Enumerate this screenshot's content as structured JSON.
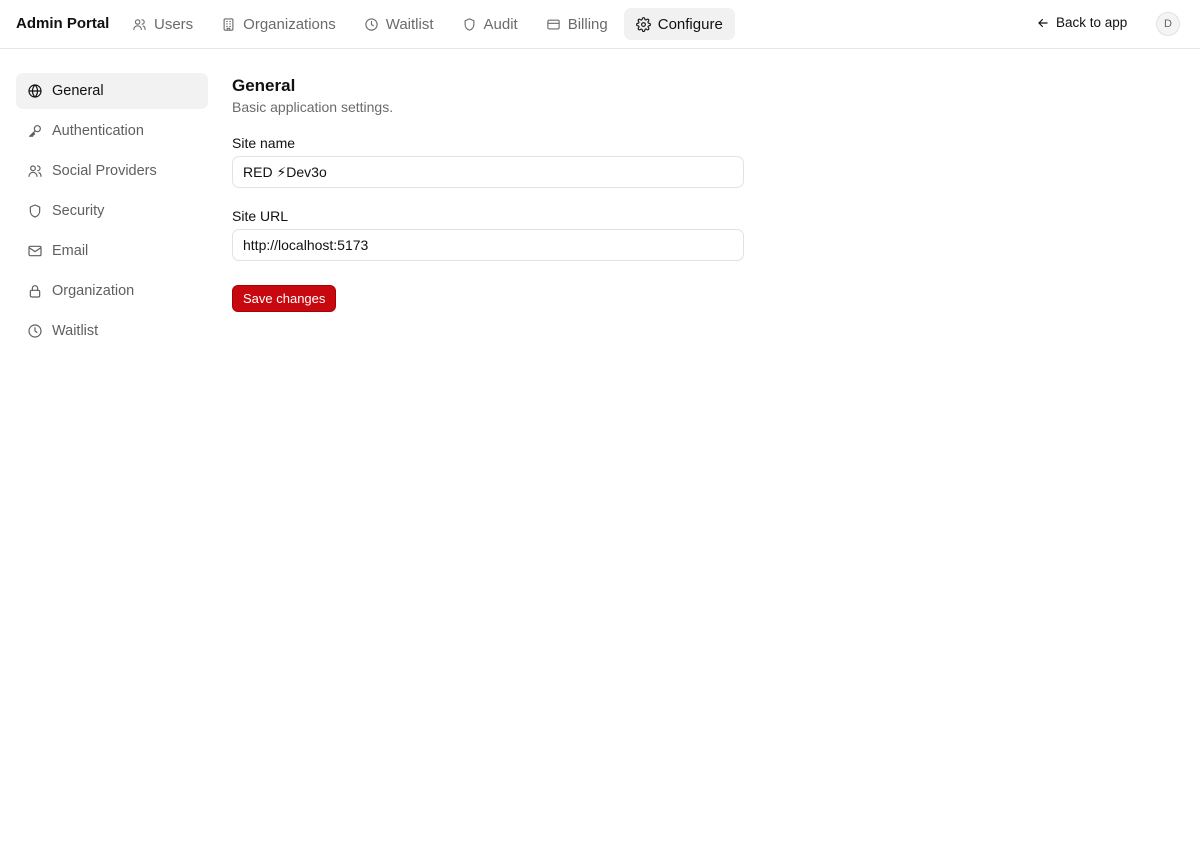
{
  "app": {
    "brand": "Admin Portal"
  },
  "topnav": {
    "items": [
      {
        "label": "Users",
        "icon": "users-icon"
      },
      {
        "label": "Organizations",
        "icon": "building-icon"
      },
      {
        "label": "Waitlist",
        "icon": "clock-icon"
      },
      {
        "label": "Audit",
        "icon": "shield-icon"
      },
      {
        "label": "Billing",
        "icon": "credit-card-icon"
      },
      {
        "label": "Configure",
        "icon": "gear-icon",
        "active": true
      }
    ],
    "back_label": "Back to app",
    "avatar_initial": "D"
  },
  "sidebar": {
    "items": [
      {
        "label": "General",
        "icon": "globe-icon",
        "active": true
      },
      {
        "label": "Authentication",
        "icon": "key-icon"
      },
      {
        "label": "Social Providers",
        "icon": "users-icon"
      },
      {
        "label": "Security",
        "icon": "shield-icon"
      },
      {
        "label": "Email",
        "icon": "mail-icon"
      },
      {
        "label": "Organization",
        "icon": "lock-icon"
      },
      {
        "label": "Waitlist",
        "icon": "clock-icon"
      }
    ]
  },
  "main": {
    "title": "General",
    "subtitle": "Basic application settings.",
    "site_name": {
      "label": "Site name",
      "value": "RED ⚡Dev3o"
    },
    "site_url": {
      "label": "Site URL",
      "value": "http://localhost:5173"
    },
    "save_label": "Save changes"
  },
  "colors": {
    "accent": "#c8080f",
    "active_bg": "#f2f2f2"
  }
}
